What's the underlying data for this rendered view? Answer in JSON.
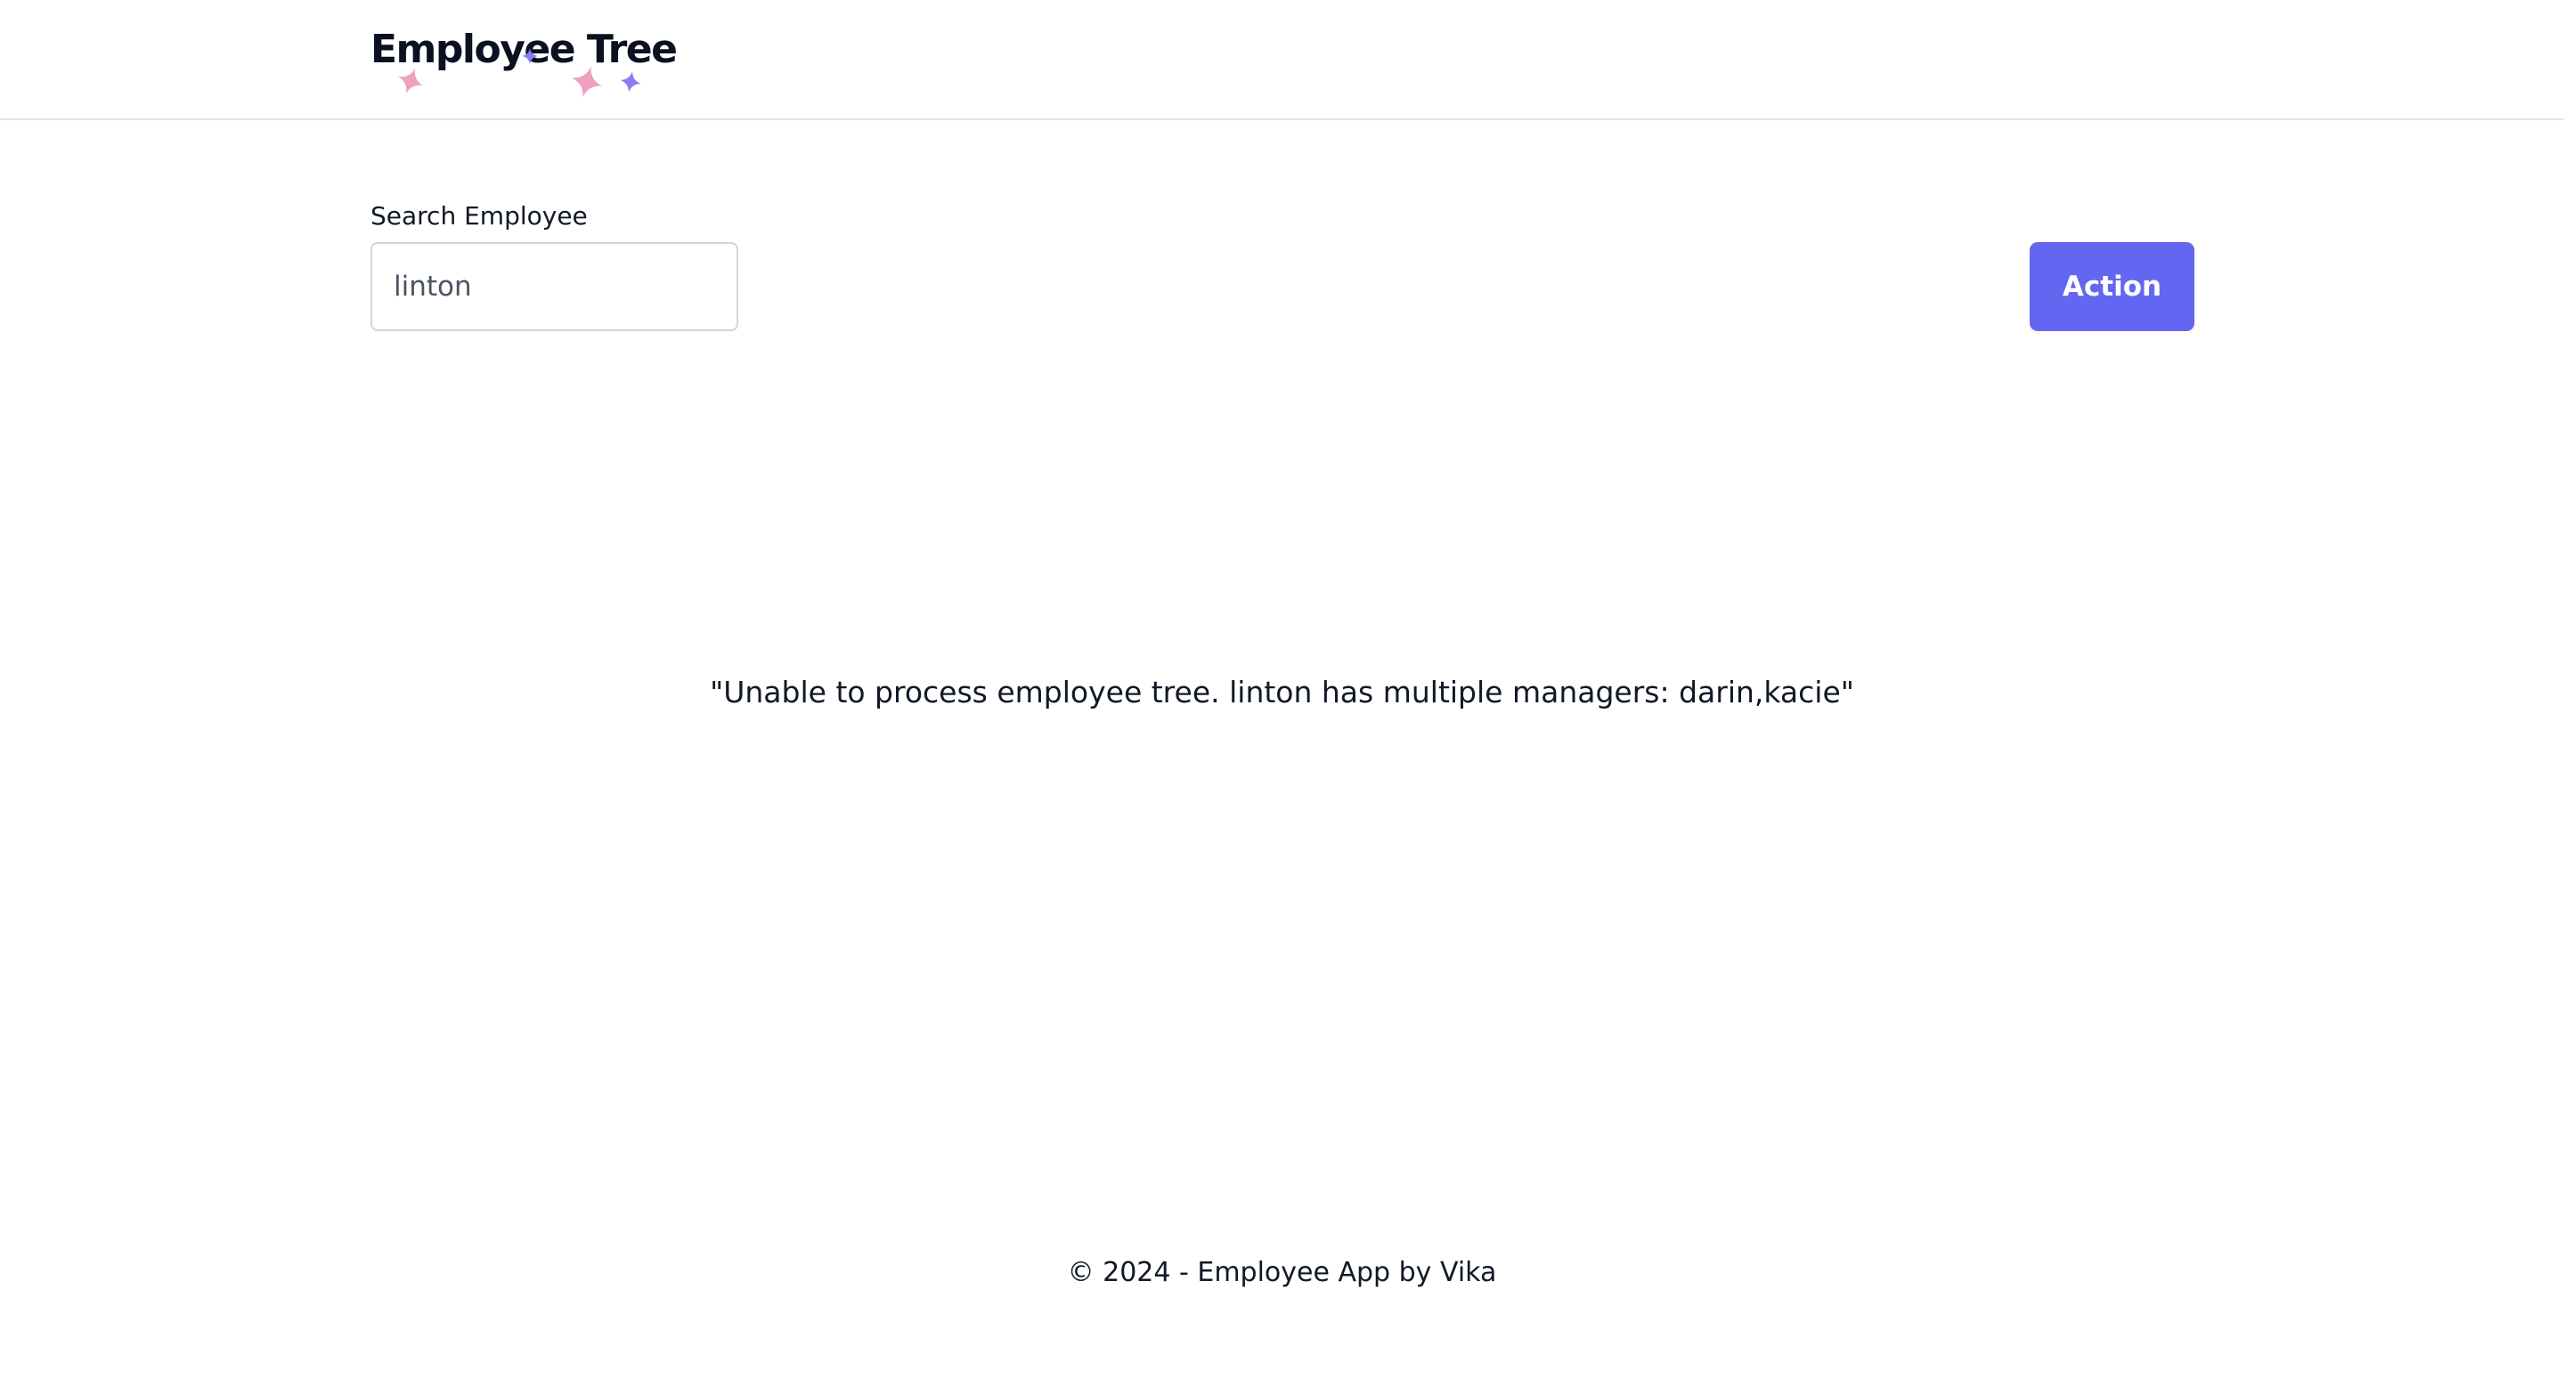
{
  "header": {
    "logo_text": "Employee Tree",
    "sparkle_colors": [
      "#f0a0c0",
      "#8b7cf6"
    ]
  },
  "search": {
    "label": "Search Employee",
    "value": "linton",
    "placeholder": ""
  },
  "toolbar": {
    "action_label": "Action",
    "accent_color": "#6366f1"
  },
  "main": {
    "message": "\"Unable to process employee tree. linton has multiple managers: darin,kacie\""
  },
  "footer": {
    "text": "© 2024 - Employee App by Vika"
  }
}
